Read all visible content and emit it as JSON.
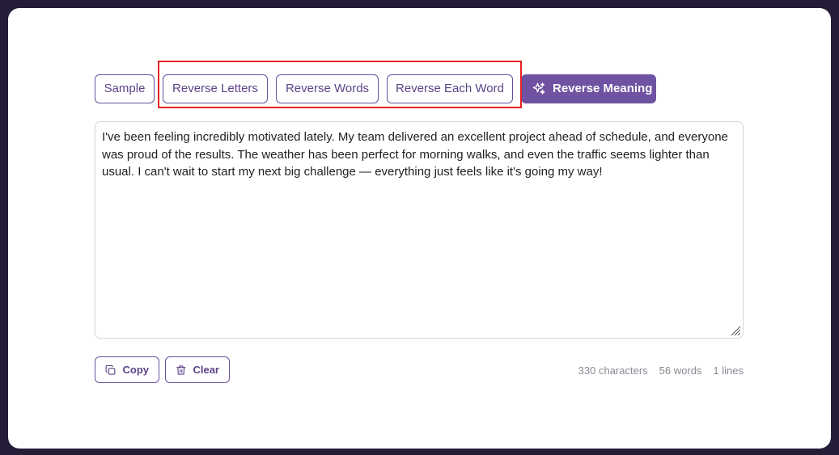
{
  "toolbar": {
    "sample_label": "Sample",
    "reverse_letters_label": "Reverse Letters",
    "reverse_words_label": "Reverse Words",
    "reverse_each_word_label": "Reverse Each Word",
    "reverse_meaning_label": "Reverse Meaning",
    "reverse_meaning_icon": "sparkle-icon"
  },
  "editor": {
    "value": "I've been feeling incredibly motivated lately. My team delivered an excellent project ahead of schedule, and everyone was proud of the results. The weather has been perfect for morning walks, and even the traffic seems lighter than usual. I can't wait to start my next big challenge — everything just feels like it's going my way!"
  },
  "actions": {
    "copy_label": "Copy",
    "copy_icon": "copy-icon",
    "clear_label": "Clear",
    "clear_icon": "trash-icon"
  },
  "stats": {
    "characters": "330 characters",
    "words": "56 words",
    "lines": "1 lines"
  },
  "colors": {
    "accent": "#6f52a1",
    "highlight": "#e52222",
    "background": "#251d38"
  }
}
